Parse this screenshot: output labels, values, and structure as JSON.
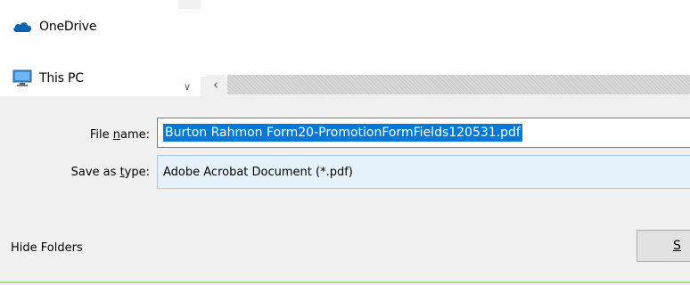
{
  "nav": {
    "items": [
      {
        "label": "OneDrive",
        "icon": "onedrive-cloud-icon"
      },
      {
        "label": "This PC",
        "icon": "this-pc-monitor-icon"
      }
    ]
  },
  "scroll": {
    "down_icon": "chevron-down-icon",
    "left_icon": "chevron-left-icon"
  },
  "form": {
    "filename_label_pre": "File ",
    "filename_label_key": "n",
    "filename_label_post": "ame:",
    "filename_value": "Burton Rahmon Form20-PromotionFormFields120531.pdf",
    "savetype_label_pre": "Save as ",
    "savetype_label_key": "t",
    "savetype_label_post": "ype:",
    "savetype_value": "Adobe Acrobat Document (*.pdf)"
  },
  "footer": {
    "hide_folders_label": "Hide Folders",
    "save_button_label": "S"
  },
  "colors": {
    "selection": "#0078d7",
    "select_bg": "#e5f1fb",
    "onedrive_blue": "#0a64ad"
  }
}
